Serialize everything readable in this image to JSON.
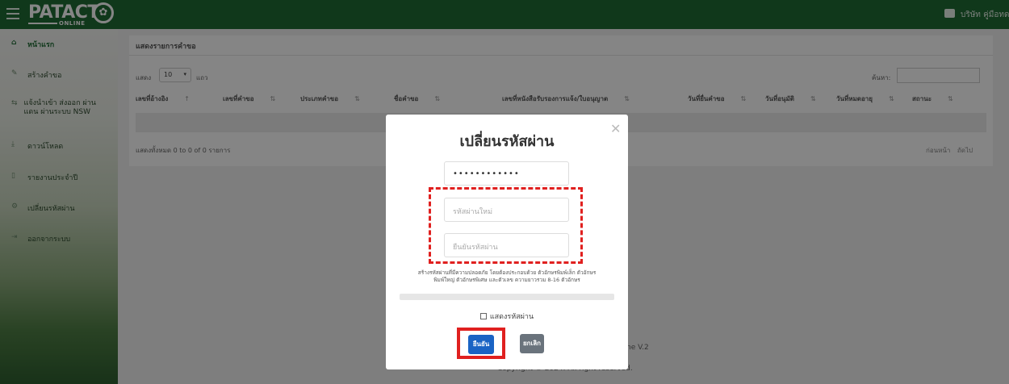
{
  "app": {
    "logo_text": "PATACT",
    "logo_sub": "ONLINE",
    "user_name": "บริษัท คู่มือทดสอบ ..."
  },
  "sidebar": {
    "items": [
      {
        "label": "หน้าแรก",
        "icon": "home-icon"
      },
      {
        "label": "สร้างคำขอ",
        "icon": "pencil-icon"
      },
      {
        "label": "แจ้งนำเข้า ส่งออก ผ่านแดน ผ่านระบบ NSW",
        "icon": "transfer-icon"
      },
      {
        "label": "ดาวน์โหลด",
        "icon": "download-icon"
      },
      {
        "label": "รายงานประจำปี",
        "icon": "file-icon"
      },
      {
        "label": "เปลี่ยนรหัสผ่าน",
        "icon": "gear-icon"
      },
      {
        "label": "ออกจากระบบ",
        "icon": "logout-icon"
      }
    ]
  },
  "main": {
    "title": "แสดงรายการคำขอ",
    "show_label": "แสดง",
    "show_value": "10",
    "show_suffix": "แถว",
    "search_label": "ค้นหา:",
    "columns": [
      "เลขที่อ้างอิง",
      "เลขที่คำขอ",
      "ประเภทคำขอ",
      "ชื่อคำขอ",
      "เลขที่หนังสือรับรองการแจ้ง/ใบอนุญาต",
      "วันที่ยื่นคำขอ",
      "วันที่อนุมัติ",
      "วันที่หมดอายุ",
      "สถานะ"
    ],
    "info": "แสดงทั้งหมด 0 to 0 of 0 รายการ",
    "prev": "ก่อนหน้า",
    "next": "ถัดไป"
  },
  "footer": {
    "version": "ne V.2",
    "copyright": "Copyright © 2024. All right reserved."
  },
  "modal": {
    "title": "เปลี่ยนรหัสผ่าน",
    "old_password_value": "••••••••••••",
    "new_password_placeholder": "รหัสผ่านใหม่",
    "confirm_password_placeholder": "ยืนยันรหัสผ่าน",
    "hint_line1": "สร้างรหัสผ่านที่มีความปลอดภัย โดยต้องประกอบด้วย ตัวอักษรพิมพ์เล็ก ตัวอักษร",
    "hint_line2": "พิมพ์ใหญ่ ตัวอักษรพิเศษ และตัวเลข ความยาวรวม 8-16 ตัวอักษร",
    "strength_percent": 0,
    "show_password_label": "แสดงรหัสผ่าน",
    "confirm_button": "ยืนยัน",
    "cancel_button": "ยกเลิก",
    "close_icon": "close-icon"
  },
  "colors": {
    "topbar": "#1f6b34",
    "primary_button": "#1a63c4",
    "secondary_button": "#6a737c",
    "highlight": "#e0201f"
  }
}
